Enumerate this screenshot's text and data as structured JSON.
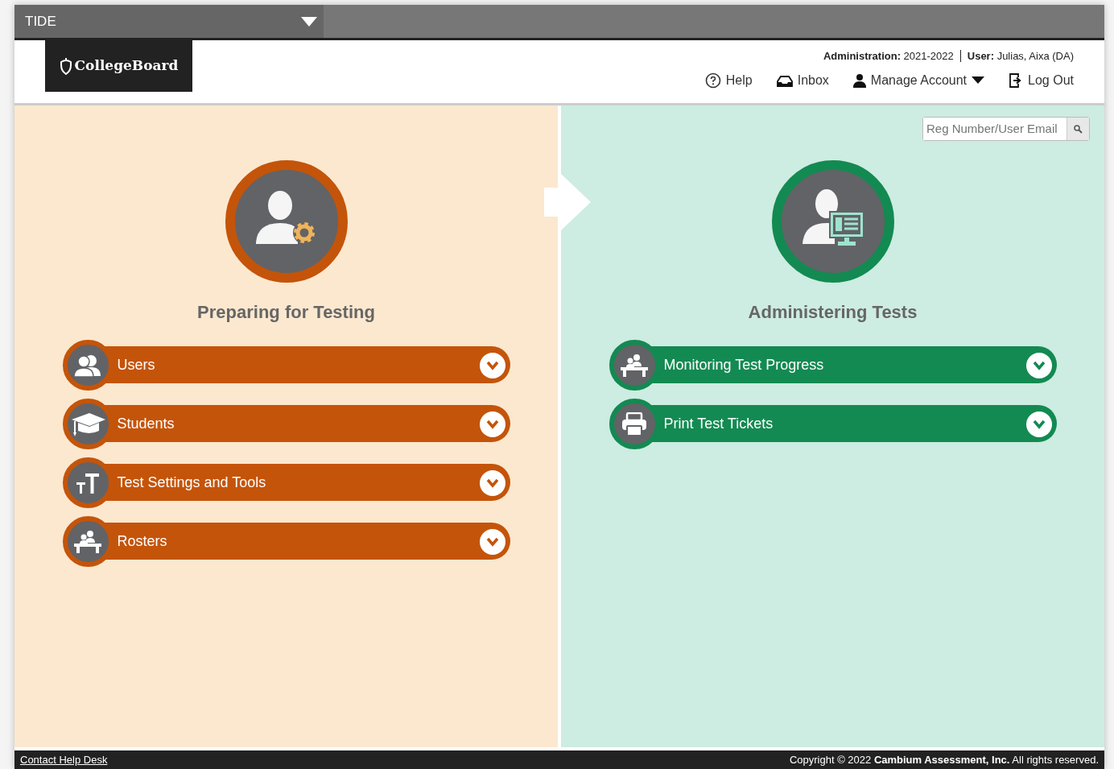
{
  "app_menu": {
    "title": "TIDE"
  },
  "logo": {
    "text": "CollegeBoard"
  },
  "header": {
    "administration": "**Administration:** 2021-2022",
    "user": "**User:** Julias, Aixa (DA)",
    "links": [
      {
        "kind": "help",
        "label": "Help"
      },
      {
        "kind": "inbox",
        "label": "Inbox"
      },
      {
        "kind": "account",
        "label": "Manage Account"
      },
      {
        "kind": "logout",
        "label": "Log Out"
      }
    ]
  },
  "search": {
    "placeholder": "Reg Number/User Email"
  },
  "sections": [
    {
      "title": "Preparing for Testing",
      "color": "#c4540a",
      "items": [
        {
          "label": "Users",
          "expanded": false
        },
        {
          "label": "Students",
          "expanded": false
        },
        {
          "label": "Test Settings and Tools",
          "expanded": false
        },
        {
          "label": "Rosters",
          "expanded": false
        }
      ]
    },
    {
      "title": "Administering Tests",
      "color": "#138a52",
      "items": [
        {
          "label": "Monitoring Test Progress",
          "expanded": false
        },
        {
          "label": "Print Test Tickets",
          "expanded": false
        }
      ]
    }
  ],
  "footer": {
    "link": "Contact Help Desk",
    "copyright": "Copyright © 2022 **Cambium Assessment, Inc.** All rights reserved."
  }
}
